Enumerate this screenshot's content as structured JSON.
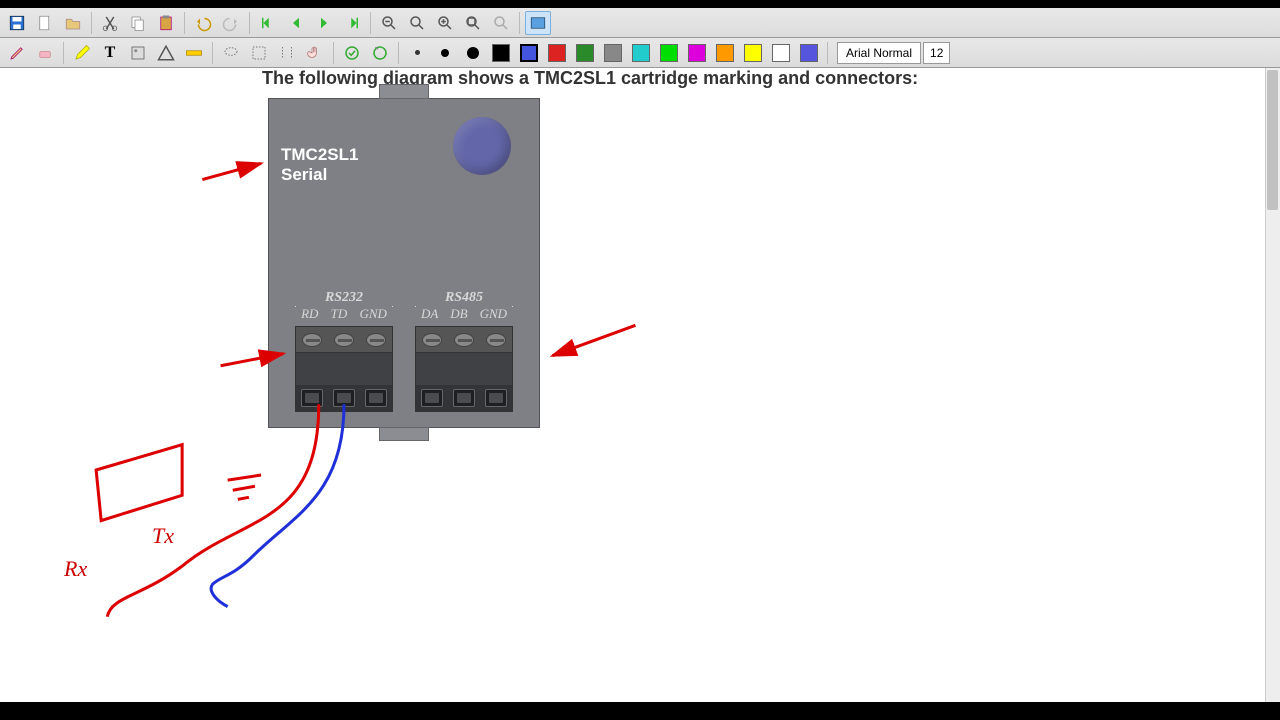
{
  "caption": "The following diagram shows a TMC2SL1 cartridge marking and connectors:",
  "module": {
    "name": "TMC2SL1",
    "sub": "Serial"
  },
  "connectors": {
    "left": {
      "title": "RS232",
      "pins": [
        "RD",
        "TD",
        "GND"
      ]
    },
    "right": {
      "title": "RS485",
      "pins": [
        "DA",
        "DB",
        "GND"
      ]
    }
  },
  "annotations": {
    "rx": "Rx",
    "tx": "Tx"
  },
  "font": {
    "name": "Arial Normal",
    "size": "12"
  },
  "colors": {
    "palette": [
      "#4455dd",
      "#d22",
      "#2a8a2a",
      "#888",
      "#2cc",
      "#0d0",
      "#d0d",
      "#f90",
      "#ff0",
      "#fff",
      "#55d"
    ]
  }
}
